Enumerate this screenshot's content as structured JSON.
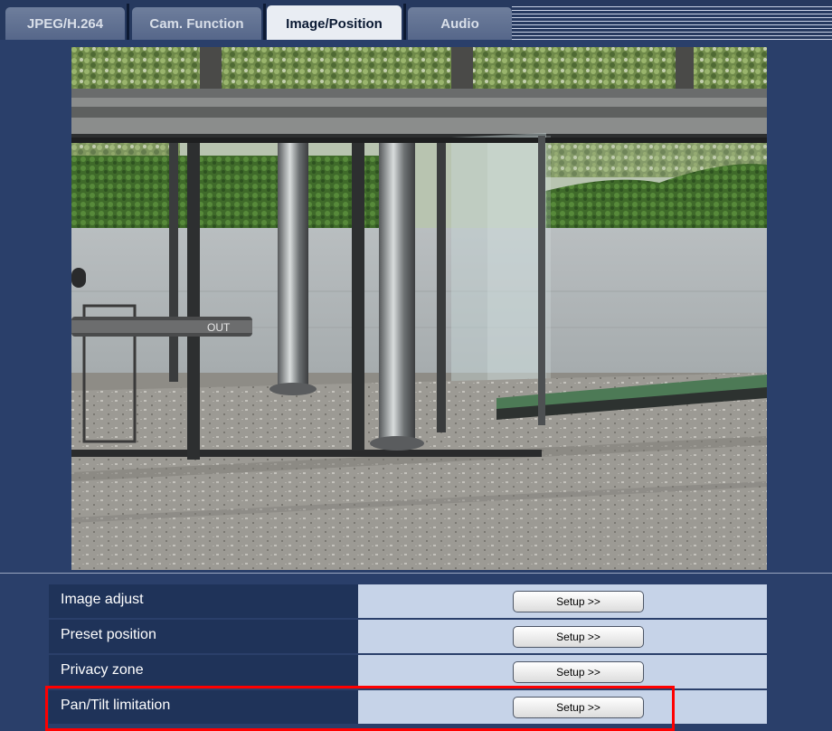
{
  "tabs": [
    {
      "label": "JPEG/H.264",
      "active": false
    },
    {
      "label": "Cam. Function",
      "active": false
    },
    {
      "label": "Image/Position",
      "active": true
    },
    {
      "label": "Audio",
      "active": false
    }
  ],
  "camera_view": {
    "scene_sign_text": "OUT"
  },
  "settings": {
    "rows": [
      {
        "label": "Image adjust",
        "button": "Setup >>"
      },
      {
        "label": "Preset position",
        "button": "Setup >>"
      },
      {
        "label": "Privacy zone",
        "button": "Setup >>"
      },
      {
        "label": "Pan/Tilt limitation",
        "button": "Setup >>"
      }
    ]
  },
  "colors": {
    "background": "#2a3f6a",
    "row_label_bg": "#1f3359",
    "row_cell_bg": "#c6d3e8",
    "active_tab_bg": "#e9edf3",
    "highlight": "#ff0000"
  }
}
